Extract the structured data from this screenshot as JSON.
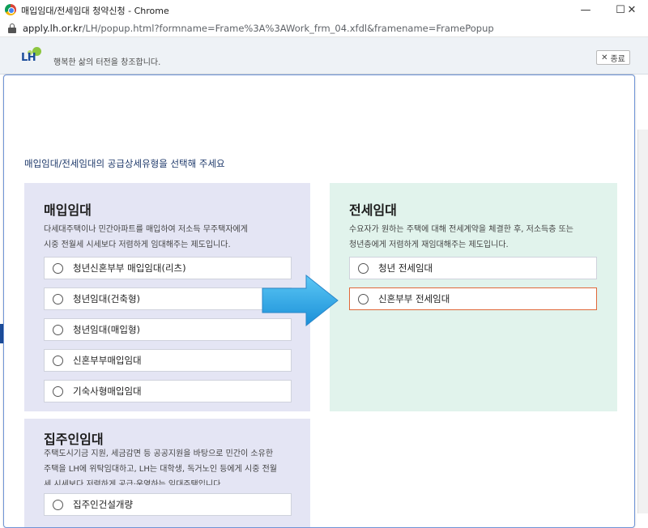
{
  "window": {
    "title": "매입임대/전세임대 청약신청 - Chrome",
    "url_domain": "apply.lh.or.kr",
    "url_path": "/LH/popup.html?formname=Frame%3A%3AWork_frm_04.xfdl&framename=FramePopup",
    "minimize_glyph": "—",
    "maximize_glyph": "☐",
    "close_glyph": "✕"
  },
  "header": {
    "logo_text": "LH",
    "slogan": "행복한 삶의 터전을 창조합니다.",
    "close_label": "종료",
    "close_glyph": "✕"
  },
  "main": {
    "instruction": "매입임대/전세임대의 공급상세유형을 선택해 주세요"
  },
  "purchase_rental": {
    "title": "매입임대",
    "desc_line1": "다세대주택이나 민간아파트를 매입하여 저소득 무주택자에게",
    "desc_line2": "시중 전월세 시세보다 저렴하게 임대해주는 제도입니다.",
    "options": [
      {
        "label": "청년신혼부부 매입임대(리츠)"
      },
      {
        "label": "청년임대(건축형)"
      },
      {
        "label": "청년임대(매입형)"
      },
      {
        "label": "신혼부부매입임대"
      },
      {
        "label": "기숙사형매입임대"
      }
    ]
  },
  "jeonse_rental": {
    "title": "전세임대",
    "desc_line1": "수요자가 원하는 주택에 대해 전세계약을 체결한 후, 저소득층 또는",
    "desc_line2": "청년층에게 저렴하게 재임대해주는 제도입니다.",
    "options": [
      {
        "label": "청년 전세임대"
      },
      {
        "label": "신혼부부 전세임대",
        "highlighted": true
      }
    ]
  },
  "landlord_rental": {
    "title": "집주인임대",
    "desc_line1": "주택도시기금 지원, 세금감면 등 공공지원을 바탕으로 민간이 소유한",
    "desc_line2": "주택을 LH에 위탁임대하고, LH는 대학생, 독거노인 등에게 시중 전월",
    "desc_line3": "세 시세보다 저렴하게 공급·운영하는 임대주택입니다.",
    "options": [
      {
        "label": "집주인건설개량"
      }
    ]
  },
  "colors": {
    "accent_blue": "#1b4c9a",
    "highlight_border": "#e0683a",
    "arrow_blue": "#2ea8ea",
    "purchase_bg": "#e4e5f4",
    "jeonse_bg": "#e1f3ec"
  },
  "icons": {
    "window_logo": "chrome-logo-icon",
    "address_lock": "lock-icon",
    "pointer_arrow": "right-arrow-icon"
  }
}
